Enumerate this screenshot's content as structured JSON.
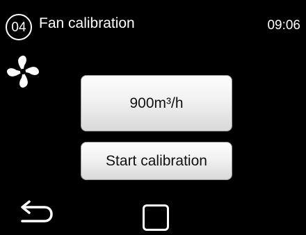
{
  "header": {
    "step_number": "04",
    "title": "Fan calibration",
    "time": "09:06"
  },
  "status": {
    "icon": "fan-icon"
  },
  "main": {
    "airflow_value": "900m³/h",
    "start_button_label": "Start calibration"
  },
  "nav": {
    "back_icon": "back-arrow-icon",
    "home_icon": "square-home-icon"
  },
  "colors": {
    "background": "#000000",
    "foreground": "#ffffff",
    "button_text": "#111111"
  }
}
